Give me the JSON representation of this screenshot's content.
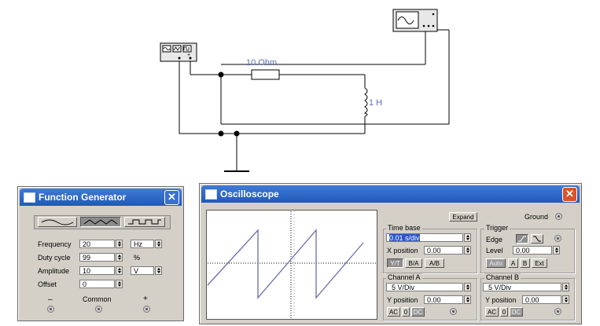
{
  "circuit": {
    "resistor_label": "10 Ohm",
    "inductor_label": "1 H",
    "label_color": "#5a6fb8"
  },
  "function_generator": {
    "title": "Function Generator",
    "waveforms": [
      "sine-wave",
      "triangle-wave",
      "square-wave"
    ],
    "selected_waveform": "triangle-wave",
    "frequency": {
      "label": "Frequency",
      "value": "20",
      "unit": "Hz"
    },
    "duty_cycle": {
      "label": "Duty cycle",
      "value": "99",
      "unit": "%"
    },
    "amplitude": {
      "label": "Amplitude",
      "value": "10",
      "unit": "V"
    },
    "offset": {
      "label": "Offset",
      "value": "0"
    },
    "terminals": {
      "minus": "–",
      "common": "Common",
      "plus": "+"
    }
  },
  "oscilloscope": {
    "title": "Oscilloscope",
    "expand_label": "Expand",
    "ground_label": "Ground",
    "time_base": {
      "title": "Time base",
      "value": "0.01 s/div",
      "x_position_label": "X position",
      "x_position": "0.00",
      "modes": [
        "Y/T",
        "B/A",
        "A/B"
      ],
      "active_mode": "Y/T"
    },
    "trigger": {
      "title": "Trigger",
      "edge_label": "Edge",
      "level_label": "Level",
      "level": "0.00",
      "buttons": [
        "Auto",
        "A",
        "B",
        "Ext"
      ]
    },
    "channel_a": {
      "title": "Channel A",
      "value": "5 V/Div",
      "y_position_label": "Y position",
      "y_position": "0.00",
      "coupling": [
        "AC",
        "0",
        "DC"
      ]
    },
    "channel_b": {
      "title": "Channel B",
      "value": "5 V/Div",
      "y_position_label": "Y position",
      "y_position": "0.00",
      "coupling": [
        "AC",
        "0",
        "DC"
      ]
    },
    "trace_color": "#6b6bb0"
  }
}
